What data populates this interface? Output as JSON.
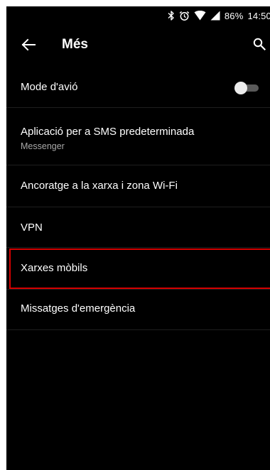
{
  "status_bar": {
    "icons": [
      "bluetooth-icon",
      "alarm-icon",
      "wifi-icon",
      "signal-icon"
    ],
    "battery": "86%",
    "time": "14:50"
  },
  "app_bar": {
    "title": "Més",
    "back_icon": "arrow-left-icon",
    "search_icon": "search-icon"
  },
  "settings": {
    "items": [
      {
        "label": "Mode d'avió",
        "toggle": "off"
      },
      {
        "label": "Aplicació per a SMS predeterminada",
        "sublabel": "Messenger"
      },
      {
        "label": "Ancoratge a la xarxa i zona Wi-Fi"
      },
      {
        "label": "VPN"
      },
      {
        "label": "Xarxes mòbils",
        "highlighted": true
      },
      {
        "label": "Missatges d'emergència"
      }
    ]
  },
  "colors": {
    "background": "#000000",
    "text_primary": "#ffffff",
    "text_secondary": "#a8a8a8",
    "highlight": "#d50000"
  }
}
